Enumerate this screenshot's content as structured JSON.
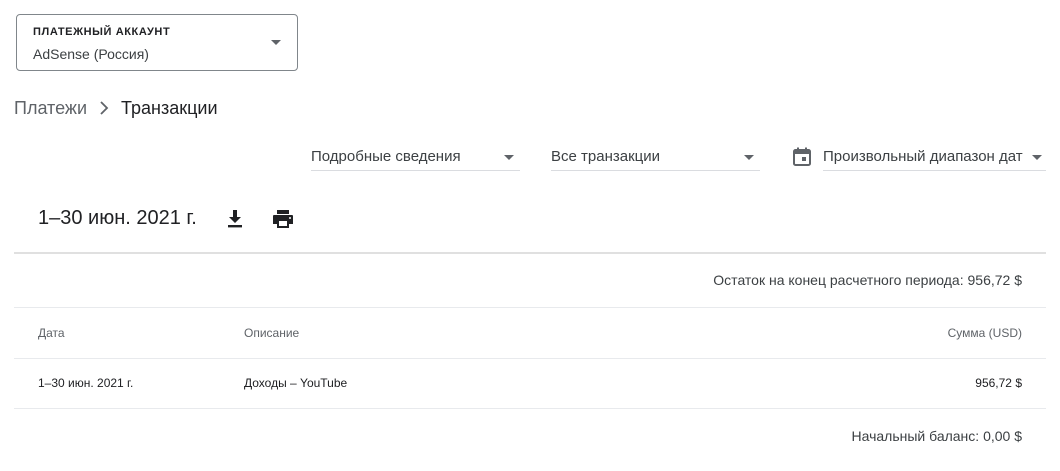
{
  "account": {
    "label": "ПЛАТЕЖНЫЙ АККАУНТ",
    "value": "AdSense (Россия)",
    "caret_icon": "arrow-drop-down-icon"
  },
  "breadcrumb": {
    "parent": "Платежи",
    "separator_icon": "chevron-right-icon",
    "current": "Транзакции"
  },
  "filters": {
    "detail": "Подробные сведения",
    "transactions": "Все транзакции",
    "date_range": "Произвольный диапазон дат",
    "calendar_icon": "calendar-icon"
  },
  "period": {
    "title": "1–30 июн. 2021 г.",
    "download_icon": "download-icon",
    "print_icon": "print-icon"
  },
  "table": {
    "end_balance": "Остаток на конец расчетного периода: 956,72 $",
    "headers": {
      "date": "Дата",
      "description": "Описание",
      "amount": "Сумма (USD)"
    },
    "rows": [
      {
        "date": "1–30 июн. 2021 г.",
        "description": "Доходы – YouTube",
        "amount": "956,72 $"
      }
    ],
    "start_balance": "Начальный баланс: 0,00 $"
  },
  "colors": {
    "text_primary": "#202124",
    "text_secondary": "#5f6368",
    "border": "#80868b",
    "divider": "#e0e0e0"
  }
}
